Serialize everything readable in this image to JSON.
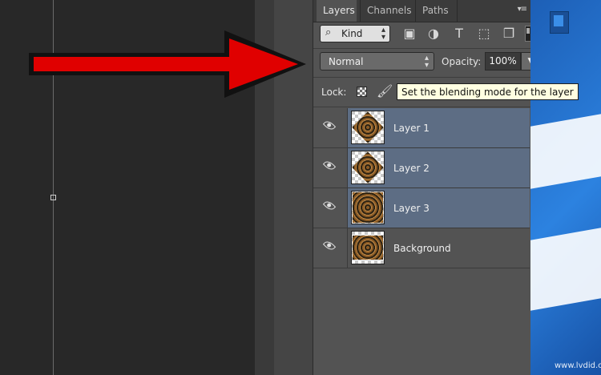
{
  "tabs": [
    {
      "label": "Layers"
    },
    {
      "label": "Channels"
    },
    {
      "label": "Paths"
    }
  ],
  "filter": {
    "kind_label": "Kind"
  },
  "blend": {
    "mode": "Normal",
    "opacity_label": "Opacity:",
    "opacity_value": "100%"
  },
  "lock": {
    "label": "Lock:"
  },
  "tooltip": {
    "text": "Set the blending mode for the layer"
  },
  "layers": [
    {
      "name": "Layer 1",
      "selected": true
    },
    {
      "name": "Layer 2",
      "selected": true
    },
    {
      "name": "Layer 3",
      "selected": true
    },
    {
      "name": "Background",
      "selected": false
    }
  ],
  "watermark": "www.lvdid.com",
  "colors": {
    "selected_row": "#5d6d84",
    "arrow": "#e00000",
    "tooltip_bg": "#ffffe1",
    "panel": "#535353"
  }
}
